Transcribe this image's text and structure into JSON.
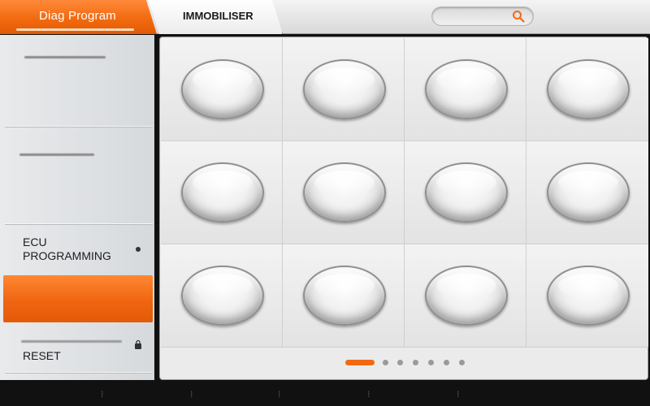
{
  "header": {
    "tabs": [
      {
        "label": "Diag Program",
        "active": true
      },
      {
        "label": "IMMOBILISER",
        "active": false
      }
    ],
    "search": {
      "value": "",
      "icon": "search-icon"
    }
  },
  "sidebar": {
    "items": [
      {
        "label": "",
        "blurred": true
      },
      {
        "label": "",
        "blurred": true
      },
      {
        "label": "ECU PROGRAMMING",
        "indicator": "dot"
      },
      {
        "label": "",
        "active": true
      },
      {
        "label": "RESET",
        "indicator": "lock"
      }
    ]
  },
  "grid": {
    "rows": 3,
    "cols": 4,
    "items": [
      "",
      "",
      "",
      "",
      "",
      "",
      "",
      "",
      "",
      "",
      "",
      ""
    ]
  },
  "pager": {
    "pages": 7,
    "current": 1
  },
  "colors": {
    "accent": "#f06a12",
    "panel": "#ebebeb",
    "sidebar": "#dfe1e3"
  }
}
